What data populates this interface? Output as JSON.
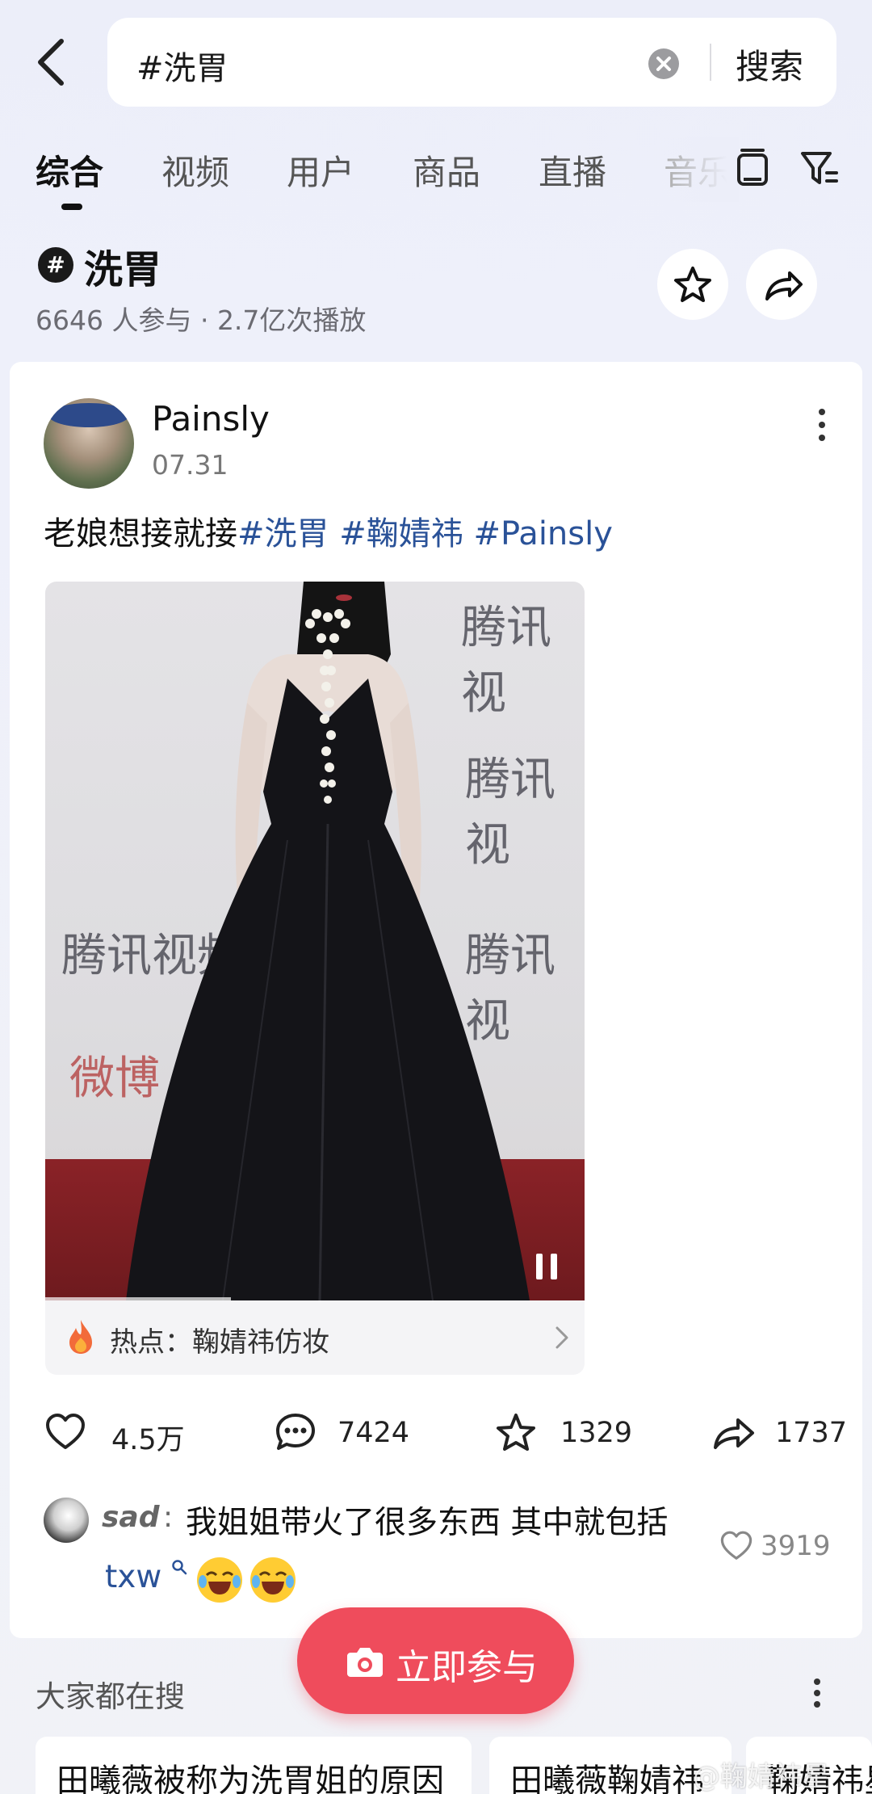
{
  "search": {
    "query": "#洗胃",
    "submit_label": "搜索"
  },
  "tabs": [
    {
      "label": "综合",
      "active": true
    },
    {
      "label": "视频",
      "active": false
    },
    {
      "label": "用户",
      "active": false
    },
    {
      "label": "商品",
      "active": false
    },
    {
      "label": "直播",
      "active": false
    },
    {
      "label": "音乐",
      "active": false
    }
  ],
  "topic": {
    "hash_symbol": "#",
    "title": "洗胃",
    "stats": "6646 人参与 · 2.7亿次播放"
  },
  "post": {
    "username": "Painsly",
    "date": "07.31",
    "text": "老娘想接就接",
    "tags": [
      "#洗胃",
      "#鞠婧祎",
      "#Painsly"
    ],
    "media_watermarks": [
      "腾讯视",
      "腾讯视",
      "腾讯视频",
      "腾讯视",
      "微博"
    ],
    "hot_topic": "热点：鞠婧祎仿妆",
    "actions": {
      "likes": "4.5万",
      "comments": "7424",
      "favorites": "1329",
      "shares": "1737"
    },
    "top_comment": {
      "user": "sad",
      "colon": ":",
      "text": "我姐姐带火了很多东西 其中就包括",
      "link_text": "txw",
      "likes": "3919"
    }
  },
  "join_button": {
    "label": "立即参与"
  },
  "trending": {
    "title": "大家都在搜",
    "items": [
      "田曦薇被称为洗胃姐的原因",
      "田曦薇鞠婧祎",
      "鞠婧祎星"
    ]
  },
  "watermark": "@鞠婧祎星"
}
